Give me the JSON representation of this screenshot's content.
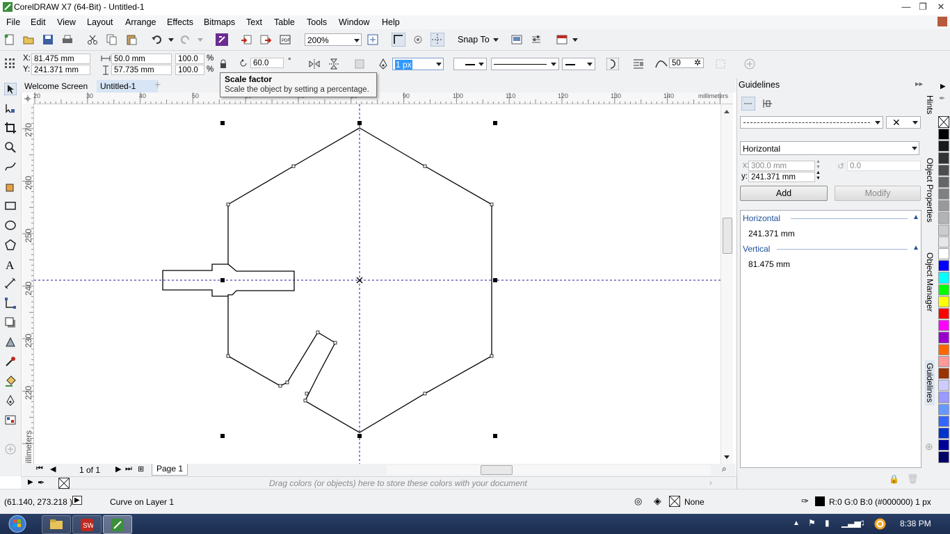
{
  "window": {
    "title": "CorelDRAW X7 (64-Bit) - Untitled-1",
    "controls": [
      "—",
      "❐",
      "✕"
    ]
  },
  "menu": [
    "File",
    "Edit",
    "View",
    "Layout",
    "Arrange",
    "Effects",
    "Bitmaps",
    "Text",
    "Table",
    "Tools",
    "Window",
    "Help"
  ],
  "toolbar": {
    "zoom": "200%",
    "snap_to": "Snap To"
  },
  "propbar": {
    "x_label": "X:",
    "x_value": "81.475 mm",
    "y_label": "Y:",
    "y_value": "241.371 mm",
    "width_value": "50.0 mm",
    "height_value": "57.735 mm",
    "scale_w": "100.0",
    "scale_h": "100.0",
    "pct": "%",
    "angle": "60.0",
    "degree": "°",
    "outline_width": "1 px",
    "smoothing": "50"
  },
  "tooltip": {
    "title": "Scale factor",
    "text": "Scale the object by setting a percentage."
  },
  "doc_tabs": [
    "Welcome Screen",
    "Untitled-1"
  ],
  "hruler": {
    "ticks": [
      "20",
      "30",
      "40",
      "50",
      "60",
      "70",
      "80",
      "90",
      "100",
      "110",
      "120",
      "130",
      "140"
    ],
    "unit": "millimeters"
  },
  "vruler": {
    "ticks": [
      "270",
      "260",
      "250",
      "240",
      "230",
      "220"
    ],
    "unit": "millimeters"
  },
  "pagenav": {
    "page_count": "1 of 1",
    "page_tab": "Page 1"
  },
  "doc_palette_hint": "Drag colors (or objects) here to store these colors with your document",
  "status": {
    "coords": "(61.140, 273.218 )",
    "object": "Curve on Layer 1",
    "fill": "None",
    "outline": "R:0 G:0 B:0 (#000000)  1 px"
  },
  "docker": {
    "title": "Guidelines",
    "orientation": "Horizontal",
    "x_label": "x:",
    "x_value": "300.0 mm",
    "y_label": "y:",
    "y_value": "241.371 mm",
    "angle_value": "0.0",
    "add_label": "Add",
    "modify_label": "Modify",
    "groups": [
      {
        "name": "Horizontal",
        "value": "241.371 mm"
      },
      {
        "name": "Vertical",
        "value": "81.475 mm"
      }
    ]
  },
  "docker_tabs": [
    "Hints",
    "Object Properties",
    "Object Manager",
    "Guidelines"
  ],
  "palette_colors": [
    "#000000",
    "#1a1a1a",
    "#333333",
    "#4d4d4d",
    "#666666",
    "#808080",
    "#999999",
    "#b3b3b3",
    "#cccccc",
    "#e6e6e6",
    "#ffffff",
    "#0000ff",
    "#00ffff",
    "#00ff00",
    "#ffff00",
    "#ff0000",
    "#ff00ff",
    "#9900cc",
    "#ff6600",
    "#ff9999",
    "#993300",
    "#ccccff",
    "#9999ff",
    "#6699ff",
    "#3366ff",
    "#0033cc",
    "#000099",
    "#000066"
  ],
  "taskbar": {
    "time": "8:38 PM"
  }
}
